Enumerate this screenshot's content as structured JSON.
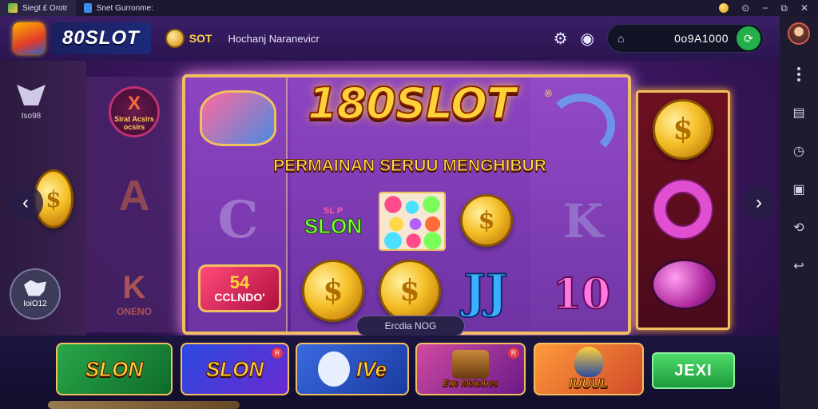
{
  "titlebar": {
    "tab1": "Siegt £ Orotr",
    "tab2": "Snet Gurronme:"
  },
  "header": {
    "brand": "80SLOT",
    "small_brand": "SOT",
    "subtitle": "Hochanj Naranevicr",
    "balance": "0o9A1000"
  },
  "side": {
    "badge_label": "Iso98",
    "dog_label": "IoiO12"
  },
  "reels": {
    "faded_top": "Sirat Acsirs",
    "faded_top2": "ocsirs",
    "faded_mid": "A",
    "faded_bottom": "ONENO",
    "left_bottom_num": "54",
    "left_bottom_word": "CCLNDO'",
    "slon_top": "SLON",
    "slon_badge": "SL P",
    "coin_glyph": "$",
    "j_glyph": "JJ",
    "ten_glyph": "10",
    "k_glyph": "K"
  },
  "overlay": {
    "title": "180SLOT",
    "reg": "®",
    "tagline": "PERMAINAN SERUU MENGHIBUR",
    "bottom_label": "Ercdia NOG"
  },
  "bottom": {
    "card1": "SLON",
    "card2": "SLON",
    "card3": "IVe",
    "card4": "Eue Meiclnes",
    "card5": "IUUUL",
    "badge2": "R",
    "badge4": "R",
    "play_button": "JEXI"
  },
  "colors": {
    "accent_gold": "#f0c060",
    "purple_bg": "#3b1760",
    "play_green": "#1d9a3a"
  }
}
